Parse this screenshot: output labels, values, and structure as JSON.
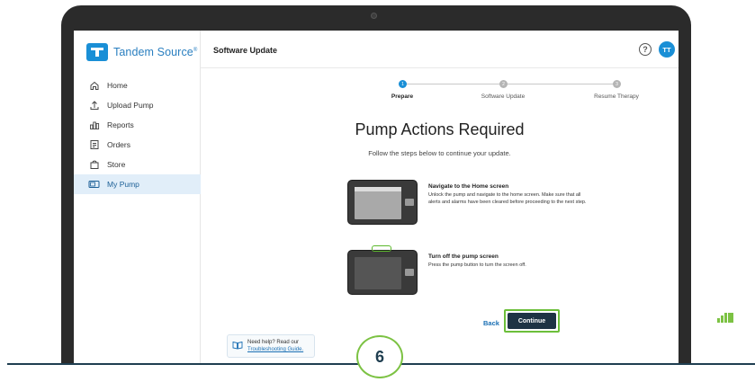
{
  "app": {
    "brand": "Tandem Source",
    "brand_tm": "®"
  },
  "sidebar": {
    "items": [
      {
        "label": "Home",
        "icon": "home-icon",
        "active": false
      },
      {
        "label": "Upload Pump",
        "icon": "upload-icon",
        "active": false
      },
      {
        "label": "Reports",
        "icon": "reports-icon",
        "active": false
      },
      {
        "label": "Orders",
        "icon": "orders-icon",
        "active": false
      },
      {
        "label": "Store",
        "icon": "store-icon",
        "active": false
      },
      {
        "label": "My Pump",
        "icon": "pump-icon",
        "active": true
      }
    ],
    "help": {
      "line1": "Need help? Read our",
      "link": "Troubleshooting Guide."
    }
  },
  "header": {
    "title": "Software Update",
    "help_symbol": "?",
    "avatar_initials": "TT"
  },
  "stepper": {
    "steps": [
      {
        "number": "1",
        "label": "Prepare",
        "active": true
      },
      {
        "number": "2",
        "label": "Software Update",
        "active": false
      },
      {
        "number": "3",
        "label": "Resume Therapy",
        "active": false
      }
    ]
  },
  "main": {
    "title": "Pump Actions Required",
    "subtitle": "Follow the steps below to continue your update.",
    "cards": [
      {
        "title": "Navigate to the Home screen",
        "body": "Unlock the pump and navigate to the home screen. Make sure that all alerts and alarms have been cleared before proceeding to the next step."
      },
      {
        "title": "Turn off the pump screen",
        "body": "Press the pump button to turn the screen off."
      }
    ],
    "back_label": "Back",
    "continue_label": "Continue"
  },
  "overlay": {
    "step_number": "6"
  },
  "colors": {
    "accent": "#1a8fd6",
    "highlight": "#6cbf3a",
    "button": "#1e3344",
    "navy": "#1f3e50"
  }
}
